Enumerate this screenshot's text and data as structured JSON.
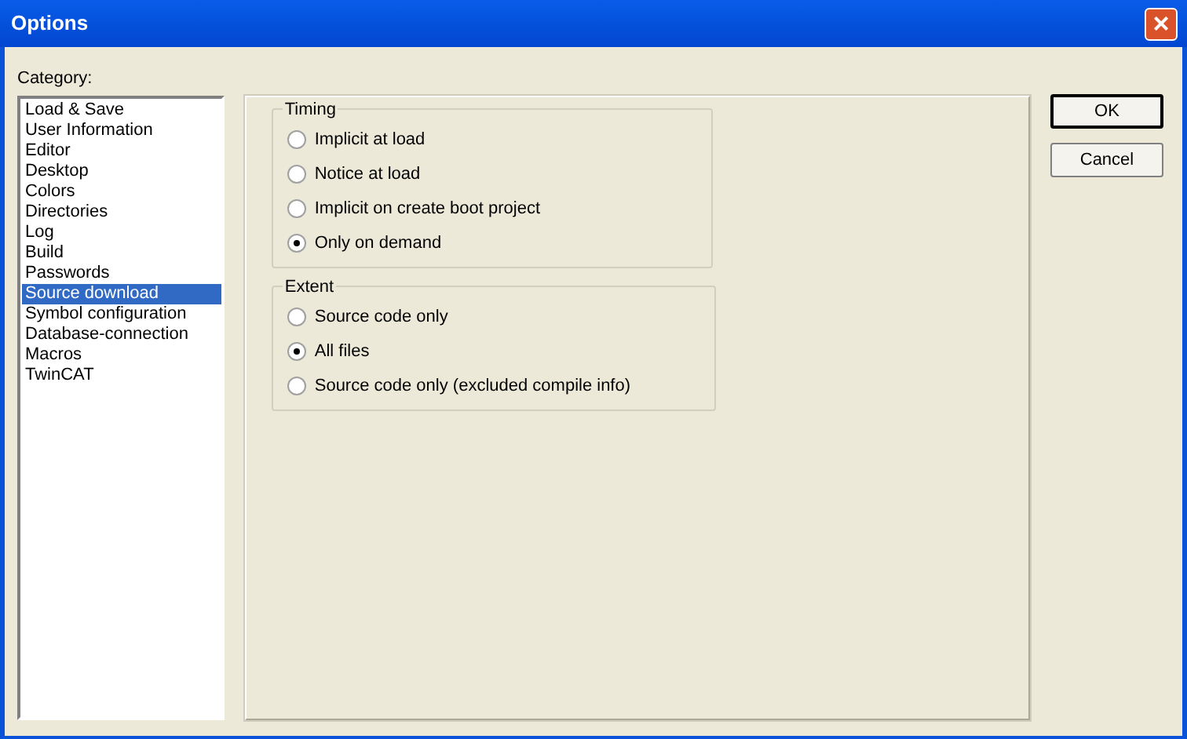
{
  "window": {
    "title": "Options",
    "close": "×"
  },
  "category_label": "Category:",
  "categories": [
    {
      "label": "Load & Save",
      "selected": false
    },
    {
      "label": "User Information",
      "selected": false
    },
    {
      "label": "Editor",
      "selected": false
    },
    {
      "label": "Desktop",
      "selected": false
    },
    {
      "label": "Colors",
      "selected": false
    },
    {
      "label": "Directories",
      "selected": false
    },
    {
      "label": "Log",
      "selected": false
    },
    {
      "label": "Build",
      "selected": false
    },
    {
      "label": "Passwords",
      "selected": false
    },
    {
      "label": "Source download",
      "selected": true
    },
    {
      "label": "Symbol configuration",
      "selected": false
    },
    {
      "label": "Database-connection",
      "selected": false
    },
    {
      "label": "Macros",
      "selected": false
    },
    {
      "label": "TwinCAT",
      "selected": false
    }
  ],
  "groups": [
    {
      "title": "Timing",
      "options": [
        {
          "label": "Implicit at load",
          "selected": false
        },
        {
          "label": "Notice at load",
          "selected": false
        },
        {
          "label": "Implicit on create boot project",
          "selected": false
        },
        {
          "label": "Only on demand",
          "selected": true
        }
      ]
    },
    {
      "title": "Extent",
      "options": [
        {
          "label": "Source code only",
          "selected": false
        },
        {
          "label": "All files",
          "selected": true
        },
        {
          "label": "Source code only (excluded compile info)",
          "selected": false
        }
      ]
    }
  ],
  "buttons": [
    {
      "label": "OK",
      "default": true
    },
    {
      "label": "Cancel",
      "default": false
    }
  ]
}
